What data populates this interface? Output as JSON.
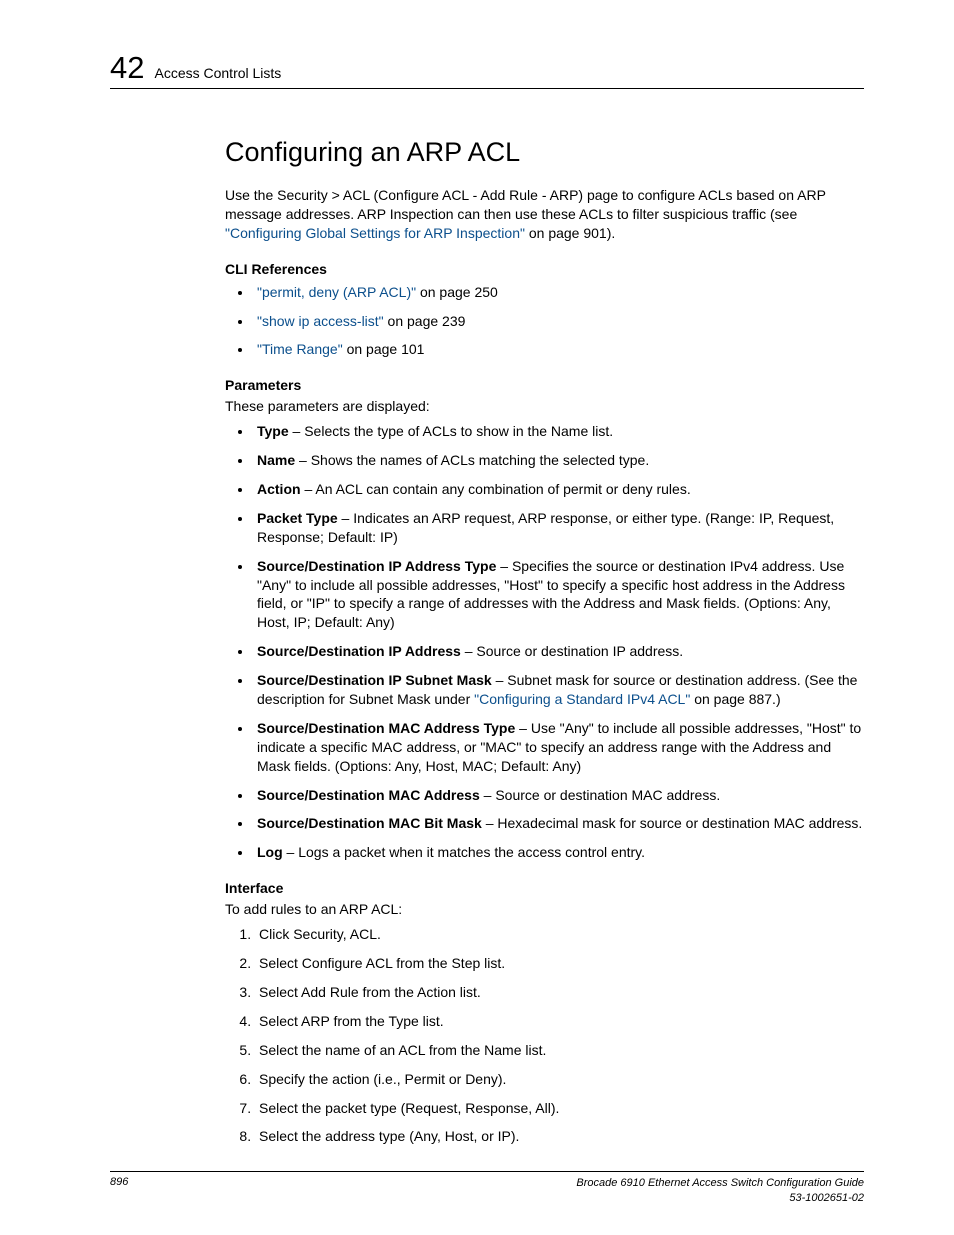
{
  "header": {
    "chapter_number": "42",
    "chapter_name": "Access Control Lists"
  },
  "section_title": "Configuring an ARP ACL",
  "intro": {
    "part1": "Use the Security > ACL (Configure ACL - Add Rule - ARP) page to configure ACLs based on ARP message addresses. ARP Inspection can then use these ACLs to filter suspicious traffic (see ",
    "link_text": "\"Configuring Global Settings for ARP Inspection\"",
    "part2": " on page 901)."
  },
  "cli_refs": {
    "heading": "CLI References",
    "items": [
      {
        "link": "\"permit, deny (ARP ACL)\"",
        "suffix": " on page 250"
      },
      {
        "link": "\"show ip access-list\"",
        "suffix": " on page 239"
      },
      {
        "link": "\"Time Range\"",
        "suffix": " on page 101"
      }
    ]
  },
  "params": {
    "heading": "Parameters",
    "intro": "These parameters are displayed:",
    "items": [
      {
        "term": "Type",
        "desc": " – Selects the type of ACLs to show in the Name list."
      },
      {
        "term": "Name",
        "desc": " – Shows the names of ACLs matching the selected type."
      },
      {
        "term": "Action",
        "desc": " – An ACL can contain any combination of permit or deny rules."
      },
      {
        "term": "Packet Type",
        "desc": " – Indicates an ARP request, ARP response, or either type. (Range: IP, Request, Response; Default: IP)"
      },
      {
        "term": "Source/Destination IP Address Type",
        "desc": " – Specifies the source or destination IPv4 address. Use \"Any\" to include all possible addresses, \"Host\" to specify a specific host address in the Address field, or \"IP\" to specify a range of addresses with the Address and Mask fields. (Options: Any, Host, IP; Default: Any)"
      },
      {
        "term": "Source/Destination IP Address",
        "desc": " – Source or destination IP address."
      },
      {
        "term": "Source/Destination IP Subnet Mask",
        "desc_pre": " – Subnet mask for source or destination address. (See the description for Subnet Mask under ",
        "link": "\"Configuring a Standard IPv4 ACL\"",
        "desc_post": " on page 887.)"
      },
      {
        "term": "Source/Destination MAC Address Type",
        "desc": " – Use \"Any\" to include all possible addresses, \"Host\" to indicate a specific MAC address, or \"MAC\" to specify an address range with the Address and Mask fields. (Options: Any, Host, MAC; Default: Any)"
      },
      {
        "term": "Source/Destination MAC Address",
        "desc": " – Source or destination MAC address."
      },
      {
        "term": "Source/Destination MAC Bit Mask",
        "desc": " – Hexadecimal mask for source or destination MAC address."
      },
      {
        "term": "Log",
        "desc": " – Logs a packet when it matches the access control entry."
      }
    ]
  },
  "interface": {
    "heading": "Interface",
    "intro": "To add rules to an ARP ACL:",
    "steps": [
      "Click Security, ACL.",
      "Select Configure ACL from the Step list.",
      "Select Add Rule from the Action list.",
      "Select ARP from the Type list.",
      "Select the name of an ACL from the Name list.",
      "Specify the action (i.e., Permit or Deny).",
      "Select the packet type (Request, Response, All).",
      "Select the address type (Any, Host, or IP)."
    ]
  },
  "footer": {
    "page": "896",
    "title": "Brocade 6910 Ethernet Access Switch Configuration Guide",
    "docnum": "53-1002651-02"
  }
}
